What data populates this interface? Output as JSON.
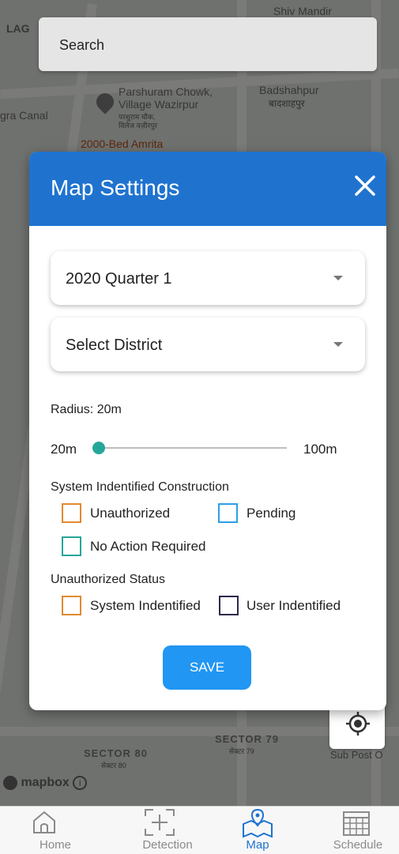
{
  "search": {
    "placeholder": "Search"
  },
  "map_labels": {
    "shiv_mandir": "Shiv Mandir",
    "lag": "LAG",
    "parshuram_en": "Parshuram Chowk,",
    "parshuram_en2": "Village Wazirpur",
    "parshuram_hi": "परशुराम चौक,",
    "parshuram_hi2": "विलेज वज़ीरपुर",
    "badshahpur_en": "Badshahpur",
    "badshahpur_hi": "बादशाहपुर",
    "gra_canal": "gra Canal",
    "bed_amrita": "2000-Bed Amrita",
    "sector80_en": "SECTOR 80",
    "sector80_hi": "सेक्टर 80",
    "sector79_en": "SECTOR 79",
    "sector79_hi": "सेक्टर 79",
    "sub_post": "Sub Post O"
  },
  "modal": {
    "title": "Map Settings",
    "quarter_select": "2020 Quarter 1",
    "district_select": "Select District",
    "radius_label": "Radius: 20m",
    "slider": {
      "min_label": "20m",
      "max_label": "100m",
      "value_fraction": 0
    },
    "construction_heading": "System Indentified Construction",
    "cb_unauthorized": "Unauthorized",
    "cb_pending": "Pending",
    "cb_no_action": "No Action Required",
    "status_heading": "Unauthorized Status",
    "cb_system": "System Indentified",
    "cb_user": "User Indentified",
    "save_label": "SAVE"
  },
  "colors": {
    "header": "#1f73cf",
    "orange": "#e08a2e",
    "blue": "#2d9ee8",
    "teal": "#26a69a",
    "navy": "#2c2a4a",
    "save": "#2196f3"
  },
  "mapbox": {
    "label": "mapbox"
  },
  "nav": {
    "home": "Home",
    "detection": "Detection",
    "map": "Map",
    "schedule": "Schedule"
  }
}
